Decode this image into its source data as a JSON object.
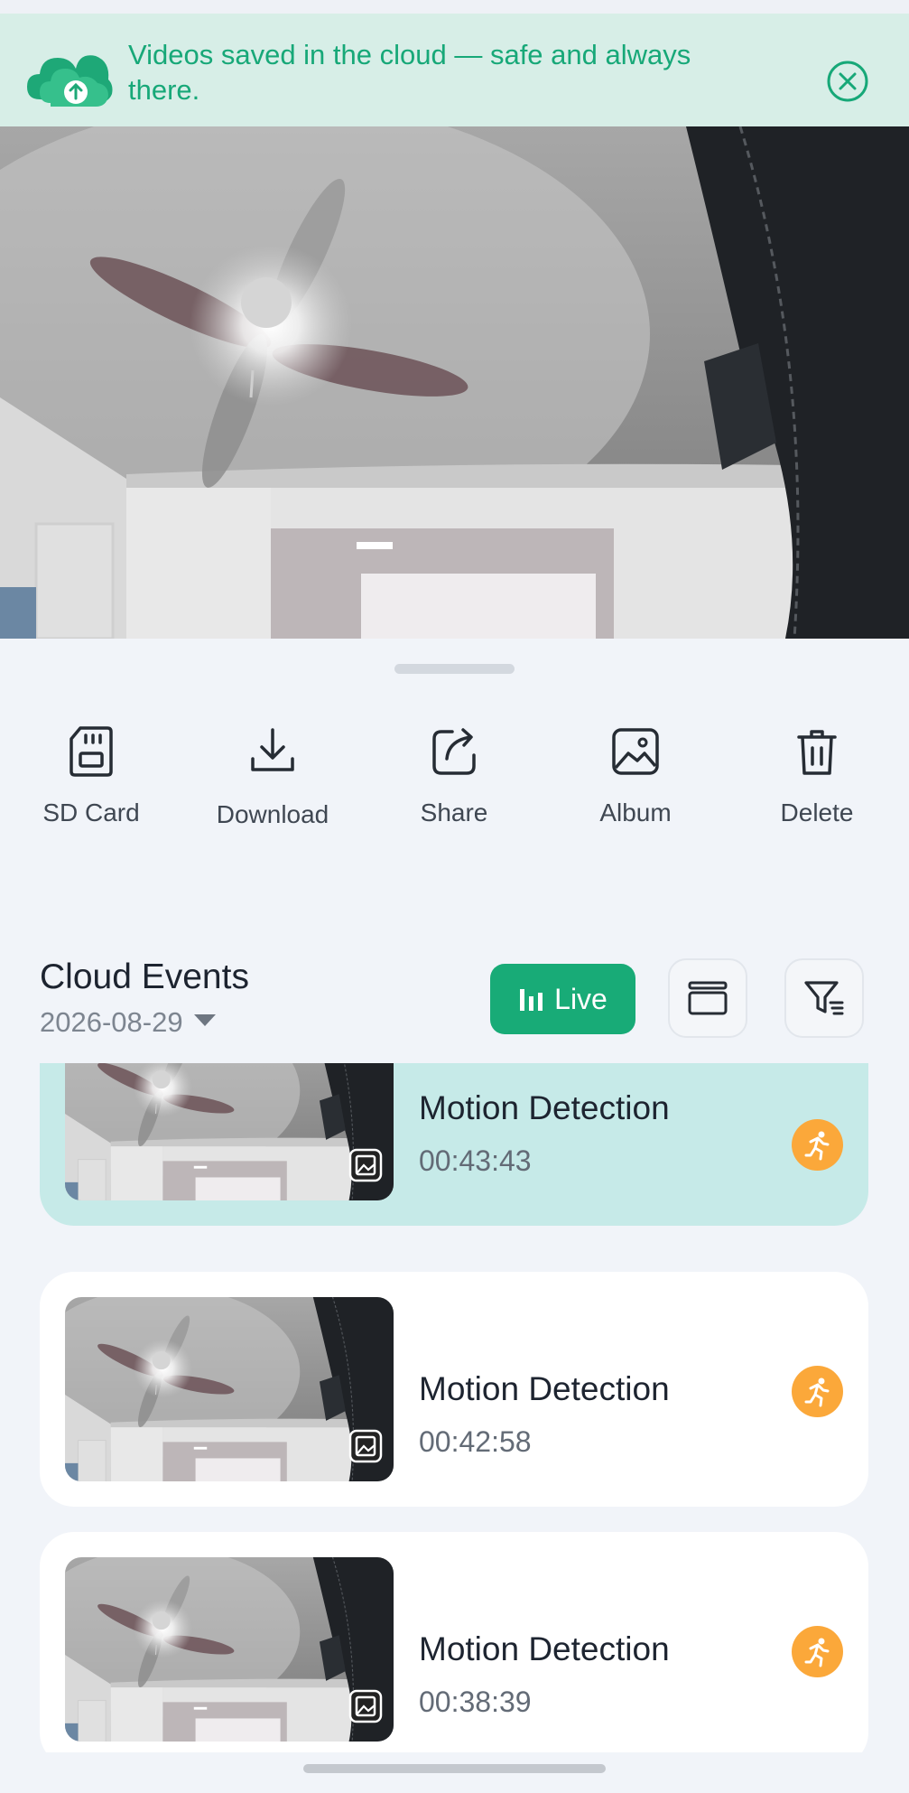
{
  "banner": {
    "message": "Videos saved in the cloud — safe and always there.",
    "icon": "cloud-upload-icon",
    "close_icon": "close-circle-icon",
    "accent": "#17a878"
  },
  "camera": {
    "description_icon": "camera-feed"
  },
  "toolbar": {
    "items": [
      {
        "label": "SD Card",
        "icon": "sd-card-icon"
      },
      {
        "label": "Download",
        "icon": "download-icon"
      },
      {
        "label": "Share",
        "icon": "share-icon"
      },
      {
        "label": "Album",
        "icon": "album-icon"
      },
      {
        "label": "Delete",
        "icon": "trash-icon"
      }
    ]
  },
  "events": {
    "title": "Cloud Events",
    "date": "2026-08-29",
    "live_label": "Live",
    "live_color": "#18ab77",
    "items": [
      {
        "name": "Motion Detection",
        "time": "00:43:43",
        "selected": true
      },
      {
        "name": "Motion Detection",
        "time": "00:42:58",
        "selected": false
      },
      {
        "name": "Motion Detection",
        "time": "00:38:39",
        "selected": false
      }
    ],
    "badge_color": "#fba83a"
  }
}
